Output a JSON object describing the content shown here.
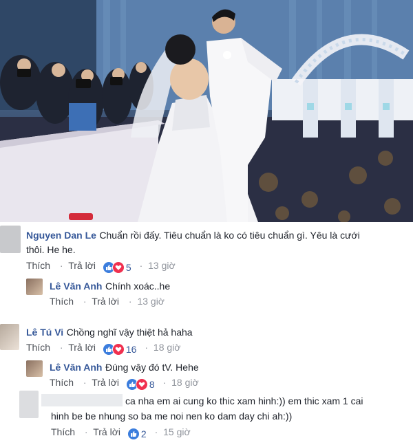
{
  "comments": [
    {
      "name": "Nguyen Dan Le",
      "text_line1": "Chuẩn rồi đấy. Tiêu chuẩn là ko có tiêu chuẩn gì. Yêu là cưới",
      "text_line2": "thôi. He he.",
      "like_label": "Thích",
      "reply_label": "Trả lời",
      "reactions": [
        "like",
        "love"
      ],
      "reaction_count": "5",
      "time": "13 giờ"
    },
    {
      "name": "Lê Văn Anh",
      "text": "Chính xoác..he",
      "like_label": "Thích",
      "reply_label": "Trả lời",
      "time": "13 giờ"
    },
    {
      "name": "Lê Tú Vi",
      "text": "Chồng nghĩ vậy thiệt hả haha",
      "like_label": "Thích",
      "reply_label": "Trả lời",
      "reactions": [
        "like",
        "love"
      ],
      "reaction_count": "16",
      "time": "18 giờ"
    },
    {
      "name": "Lê Văn Anh",
      "text": "Đúng vậy đó tV. Hehe",
      "like_label": "Thích",
      "reply_label": "Trả lời",
      "reactions": [
        "like",
        "love"
      ],
      "reaction_count": "8",
      "time": "18 giờ"
    },
    {
      "name": "",
      "text_line1": "ca nha em ai cung ko thic xam hinh:)) em thic xam 1 cai",
      "text_line2": "hinh be be nhung so ba me noi nen ko dam day chi ah:))",
      "like_label": "Thích",
      "reply_label": "Trả lời",
      "reactions": [
        "like"
      ],
      "reaction_count": "2",
      "time": "15 giờ"
    }
  ],
  "colors": {
    "name": "#365899",
    "like": "#3b7ddd",
    "love": "#f0304f",
    "meta": "#90949c"
  }
}
